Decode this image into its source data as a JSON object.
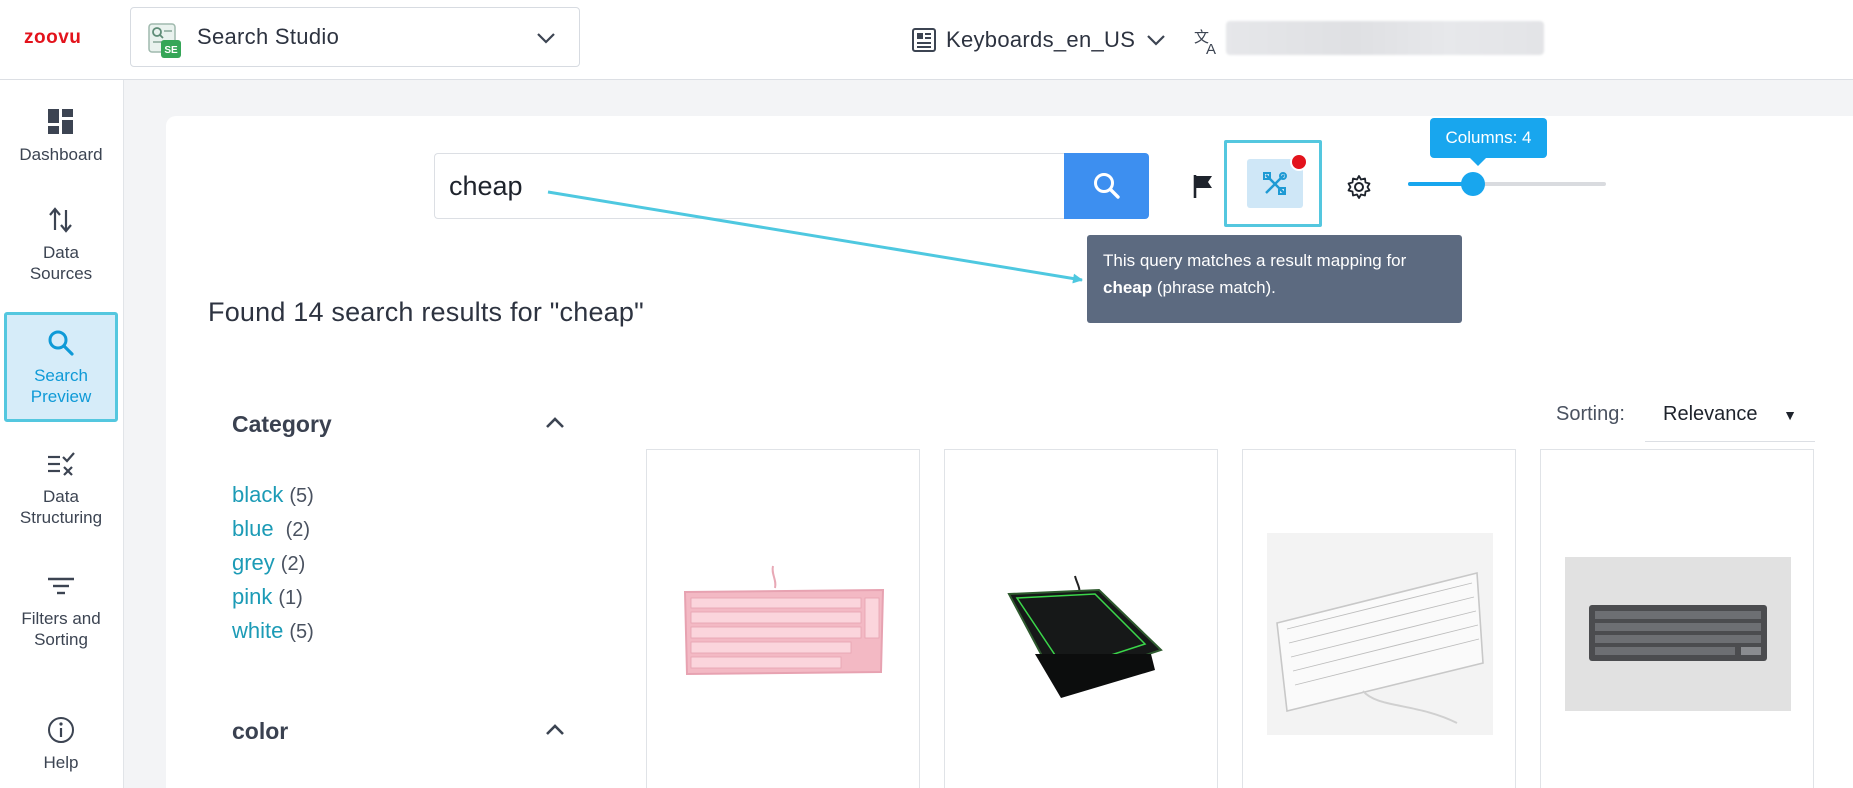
{
  "app": {
    "logo_text": "zoovu",
    "current_app": "Search Studio",
    "current_app_icon": "search-studio-icon",
    "app_badge": "SE",
    "catalog": "Keyboards_en_US",
    "brand_red": "#e3131c"
  },
  "sidebar": {
    "items": [
      {
        "label": "Dashboard",
        "icon": "dashboard-icon"
      },
      {
        "label": "Data Sources",
        "icon": "data-sources-icon"
      },
      {
        "label": "Search Preview",
        "icon": "search-icon",
        "active": true
      },
      {
        "label": "Data Structuring",
        "icon": "data-structuring-icon"
      },
      {
        "label": "Filters and Sorting",
        "icon": "filter-icon"
      },
      {
        "label": "Help",
        "icon": "help-icon"
      }
    ]
  },
  "search": {
    "query": "cheap",
    "button_color": "#3d8ff0"
  },
  "toolbar": {
    "columns_label": "Columns: 4",
    "columns_value": 4,
    "columns_min": 1,
    "columns_max": 10,
    "accent": "#18a6ee"
  },
  "tooltip": {
    "text_before": "This query matches a result mapping for ",
    "term": "cheap",
    "text_after": " (phrase match)."
  },
  "results": {
    "title": "Found 14 search results for \"cheap\""
  },
  "facets": {
    "category": {
      "title": "Category",
      "values": [
        {
          "label": "black",
          "count": "(5)"
        },
        {
          "label": "blue",
          "count": "(2)"
        },
        {
          "label": "grey",
          "count": "(2)"
        },
        {
          "label": "pink",
          "count": "(1)"
        },
        {
          "label": "white",
          "count": "(5)"
        }
      ]
    },
    "color": {
      "title": "color"
    }
  },
  "sorting": {
    "label": "Sorting:",
    "value": "Relevance"
  },
  "products": [
    {
      "image": "pink-keyboard"
    },
    {
      "image": "black-green-gaming-keyboard"
    },
    {
      "image": "white-keyboard"
    },
    {
      "image": "grey-keyboard"
    }
  ]
}
